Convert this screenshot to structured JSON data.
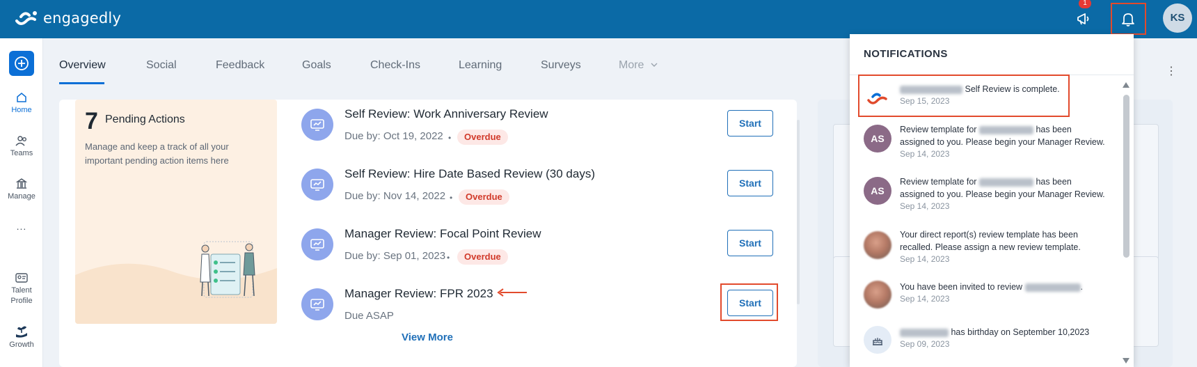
{
  "app": {
    "name": "engagedly",
    "brand_color": "#0b6aa6",
    "accent_color": "#0b6fd6"
  },
  "header": {
    "announcement_badge": "1",
    "avatar_initials": "KS",
    "icons": [
      "megaphone-icon",
      "bell-icon"
    ]
  },
  "sidebar": {
    "items": [
      {
        "label": "Home",
        "icon": "home-icon"
      },
      {
        "label": "Teams",
        "icon": "teams-icon"
      },
      {
        "label": "Manage",
        "icon": "manage-icon"
      },
      {
        "label": "...",
        "icon": "more-icon"
      },
      {
        "label": "Talent Profile",
        "icon": "id-card-icon"
      },
      {
        "label": "Growth",
        "icon": "growth-icon"
      }
    ]
  },
  "tabs": [
    {
      "label": "Overview"
    },
    {
      "label": "Social"
    },
    {
      "label": "Feedback"
    },
    {
      "label": "Goals"
    },
    {
      "label": "Check-Ins"
    },
    {
      "label": "Learning"
    },
    {
      "label": "Surveys"
    },
    {
      "label": "More"
    }
  ],
  "pending": {
    "count": "7",
    "title": "Pending Actions",
    "description": "Manage and keep a track of all your important pending action items here"
  },
  "actions": [
    {
      "title": "Self Review: Work Anniversary Review",
      "due": "Due by: Oct 19, 2022",
      "status": "Overdue",
      "button": "Start"
    },
    {
      "title": "Self Review: Hire Date Based Review (30 days)",
      "due": "Due by: Nov 14, 2022",
      "status": "Overdue",
      "button": "Start"
    },
    {
      "title": "Manager Review: Focal Point Review",
      "due": "Due by: Sep 01, 2023",
      "status": "Overdue",
      "button": "Start"
    },
    {
      "title": "Manager Review:  FPR 2023",
      "due": "Due ASAP",
      "status": "",
      "button": "Start"
    }
  ],
  "view_more": "View More",
  "notifications": {
    "title": "NOTIFICATIONS",
    "items": [
      {
        "avatar": "engagedly-logo",
        "text": "Self Review is complete.",
        "date": "Sep 15, 2023"
      },
      {
        "avatar": "AS",
        "text_a": "Review template for",
        "text_b": "has been assigned to you. Please begin your Manager Review.",
        "date": "Sep 14, 2023"
      },
      {
        "avatar": "AS",
        "text_a": "Review template for",
        "text_b": "has been assigned to you. Please begin your Manager Review.",
        "date": "Sep 14, 2023"
      },
      {
        "avatar": "photo",
        "text": "Your direct report(s) review template has been recalled. Please assign a new review template.",
        "date": "Sep 14, 2023"
      },
      {
        "avatar": "photo",
        "text_a": "You have been invited to review",
        "text_b": ".",
        "date": "Sep 14, 2023"
      },
      {
        "avatar": "cake",
        "text": "has birthday on September 10,2023",
        "date": "Sep 09, 2023"
      }
    ]
  }
}
